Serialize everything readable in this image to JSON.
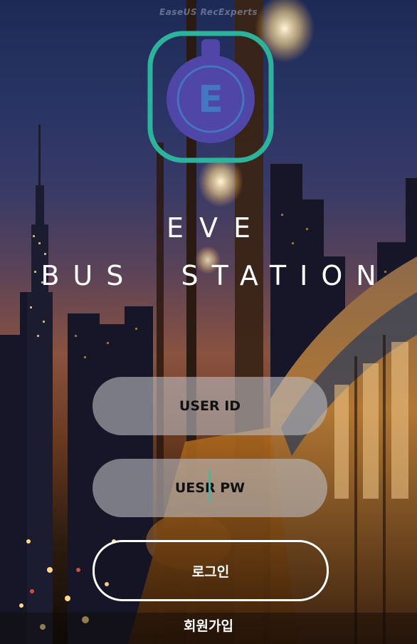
{
  "watermark": "EaseUS RecExperts",
  "logo": {
    "letter": "E",
    "ring_color": "#2db39c",
    "badge_color": "#4f46a8"
  },
  "title": {
    "line1": "EVE",
    "line2": "BUS  STATION"
  },
  "login_form": {
    "user_id_placeholder": "USER ID",
    "password_placeholder": "UESR PW",
    "login_label": "로그인",
    "signup_label": "회원가입"
  },
  "colors": {
    "accent": "#27c3b3",
    "field_bg": "#b9b9be",
    "text_light": "#ffffff"
  }
}
